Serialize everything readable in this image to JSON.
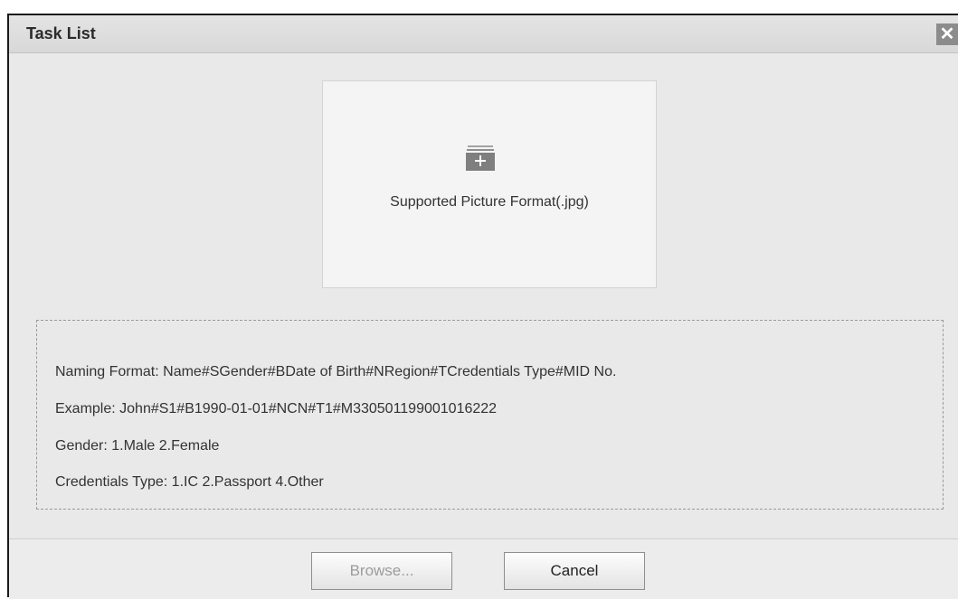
{
  "dialog": {
    "title": "Task List",
    "close_glyph": "✕"
  },
  "upload": {
    "icon": "folder-plus-icon",
    "label": "Supported Picture Format(.jpg)"
  },
  "info": {
    "naming_format": "Naming Format:  Name#SGender#BDate of Birth#NRegion#TCredentials Type#MID No.",
    "example": "Example:  John#S1#B1990-01-01#NCN#T1#M330501199001016222",
    "gender": "Gender:  1.Male 2.Female",
    "credentials_type": "Credentials Type:  1.IC 2.Passport 4.Other"
  },
  "footer": {
    "browse_label": "Browse...",
    "cancel_label": "Cancel"
  },
  "colors": {
    "dialog_bg": "#e9e9e9",
    "upload_bg": "#f4f4f4",
    "icon_gray": "#7f7f7f",
    "disabled_text": "#9c9c9c"
  }
}
